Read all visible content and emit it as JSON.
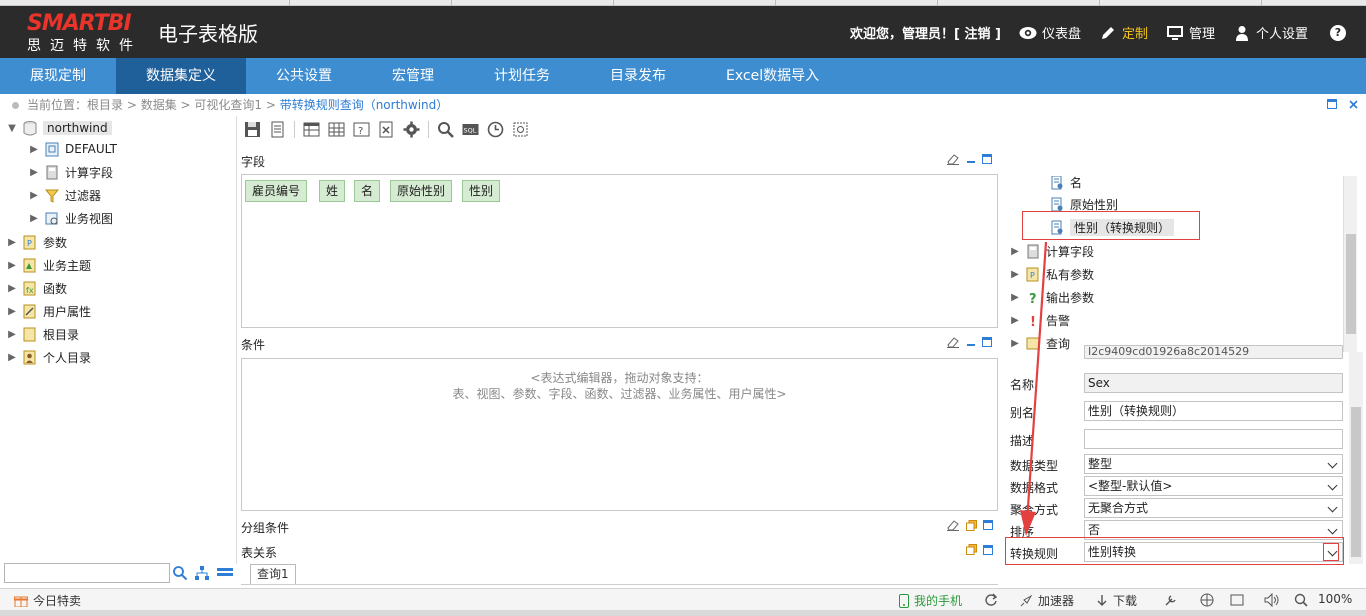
{
  "header": {
    "logo_main": "SMARTBI",
    "logo_sub": "思迈特软件",
    "product": "电子表格版",
    "welcome": "欢迎您，管理员！[ 注销 ]",
    "dashboard": "仪表盘",
    "customize": "定制",
    "manage": "管理",
    "personal": "个人设置",
    "help": "?"
  },
  "nav": [
    "展现定制",
    "数据集定义",
    "公共设置",
    "宏管理",
    "计划任务",
    "目录发布",
    "Excel数据导入"
  ],
  "breadcrumb": {
    "prefix": "当前位置：",
    "path": "根目录 > 数据集 > 可视化查询1 > ",
    "current": "带转换规则查询（northwind）"
  },
  "left_tree": [
    {
      "label": "northwind"
    },
    {
      "label": "DEFAULT"
    },
    {
      "label": "计算字段"
    },
    {
      "label": "过滤器"
    },
    {
      "label": "业务视图"
    },
    {
      "label": "参数"
    },
    {
      "label": "业务主题"
    },
    {
      "label": "函数"
    },
    {
      "label": "用户属性"
    },
    {
      "label": "根目录"
    },
    {
      "label": "个人目录"
    }
  ],
  "sections": {
    "fields": "字段",
    "conditions": "条件",
    "group": "分组条件",
    "relations": "表关系"
  },
  "field_chips": [
    "雇员编号",
    "姓",
    "名",
    "原始性别",
    "性别"
  ],
  "editor_hint": {
    "line1": "<表达式编辑器，拖动对象支持：",
    "line2": "表、视图、参数、字段、函数、过滤器、业务属性、用户属性>"
  },
  "query_tab": "查询1",
  "right_tree": [
    {
      "label": "名"
    },
    {
      "label": "原始性别"
    },
    {
      "label": "性别（转换规则）"
    },
    {
      "label": "计算字段"
    },
    {
      "label": "私有参数"
    },
    {
      "label": "输出参数"
    },
    {
      "label": "告警"
    },
    {
      "label": "查询"
    }
  ],
  "props": {
    "id_value": "I2c9409cd01926a8c2014529",
    "name_label": "名称",
    "name_value": "Sex",
    "alias_label": "别名",
    "alias_value": "性别（转换规则）",
    "desc_label": "描述",
    "desc_value": "",
    "type_label": "数据类型",
    "type_value": "整型",
    "format_label": "数据格式",
    "format_value": "<整型-默认值>",
    "agg_label": "聚合方式",
    "agg_value": "无聚合方式",
    "sort_label": "排序",
    "sort_value": "否",
    "rule_label": "转换规则",
    "rule_value": "性别转换"
  },
  "status": {
    "left": "今日特卖",
    "phone": "我的手机",
    "accel": "加速器",
    "download": "下载",
    "zoom": "100%"
  },
  "colors": {
    "header_bg": "#2b2b2b",
    "nav_bg": "#3d8dd0",
    "nav_active": "#1f5f9a",
    "accent": "#2e7dd6",
    "highlight": "#e34040",
    "chip_bg": "#d6ecd2"
  }
}
